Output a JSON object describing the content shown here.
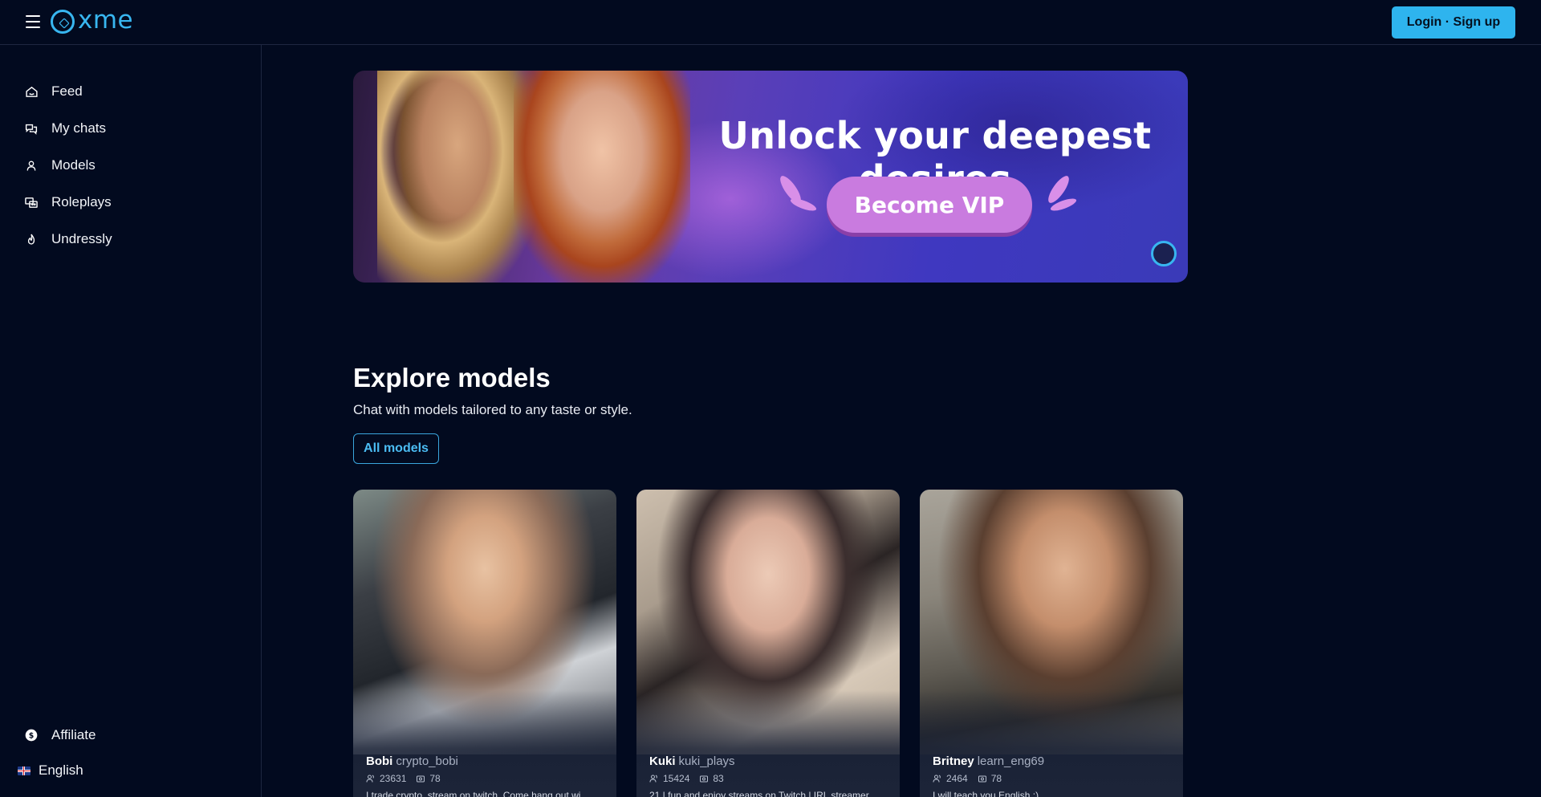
{
  "app": {
    "name": "xme"
  },
  "header": {
    "login_label": "Login · Sign up"
  },
  "sidebar": {
    "items": [
      {
        "label": "Feed",
        "icon": "home-icon"
      },
      {
        "label": "My chats",
        "icon": "chat-bubbles-icon"
      },
      {
        "label": "Models",
        "icon": "person-icon"
      },
      {
        "label": "Roleplays",
        "icon": "roleplay-icon"
      },
      {
        "label": "Undressly",
        "icon": "flame-icon"
      }
    ],
    "affiliate_label": "Affiliate",
    "language": {
      "label": "English",
      "icon": "uk-flag-icon"
    }
  },
  "banner": {
    "title": "Unlock your deepest desires",
    "cta_label": "Become VIP"
  },
  "explore": {
    "title": "Explore models",
    "subtitle": "Chat with models tailored to any taste or style.",
    "all_models_label": "All models"
  },
  "models": [
    {
      "name": "Bobi",
      "handle": "crypto_bobi",
      "followers": "23631",
      "images": "78",
      "description": "I trade crypto, stream on twitch. Come hang out wi"
    },
    {
      "name": "Kuki",
      "handle": "kuki_plays",
      "followers": "15424",
      "images": "83",
      "description": "21 | fun and enjoy streams on Twitch | IRL streamer"
    },
    {
      "name": "Britney",
      "handle": "learn_eng69",
      "followers": "2464",
      "images": "78",
      "description": "I will teach you English ;)"
    }
  ],
  "colors": {
    "background": "#020a1f",
    "accent": "#2eb4ee",
    "vip": "#c97bdf"
  }
}
